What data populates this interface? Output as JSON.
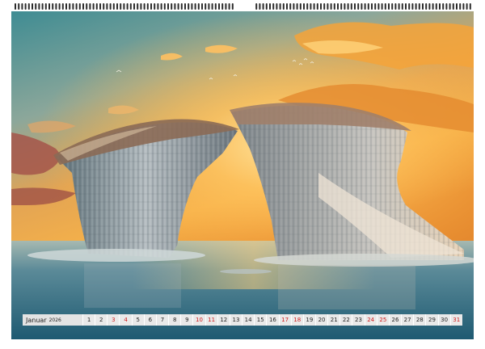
{
  "calendar": {
    "month": "Januar",
    "year": "2026",
    "days": [
      "1",
      "2",
      "3",
      "4",
      "5",
      "6",
      "7",
      "8",
      "9",
      "10",
      "11",
      "12",
      "13",
      "14",
      "15",
      "16",
      "17",
      "18",
      "19",
      "20",
      "21",
      "22",
      "23",
      "24",
      "25",
      "26",
      "27",
      "28",
      "29",
      "30",
      "31"
    ],
    "weekend_days": [
      "3",
      "4",
      "10",
      "11",
      "17",
      "18",
      "24",
      "25",
      "31"
    ],
    "holiday_days": [
      "1",
      "6"
    ]
  },
  "colors": {
    "weekday_text": "#222222",
    "weekend_text": "#d01a1a",
    "strip_cell": "#e9e9e9",
    "month_cell": "#e4e4e4"
  },
  "photo": {
    "subject": "sea-arch-rock-formation-at-sunset"
  }
}
